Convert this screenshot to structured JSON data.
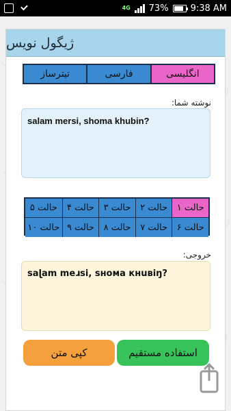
{
  "status_bar": {
    "network_label": "4G",
    "battery": "73%",
    "time": "9:38 AM"
  },
  "app": {
    "title": "ژیگول نویس"
  },
  "tabs": [
    {
      "label": "انگلیسی",
      "active": true
    },
    {
      "label": "فارسی",
      "active": false
    },
    {
      "label": "تیترساز",
      "active": false
    }
  ],
  "input": {
    "label": "نوشته شما:",
    "value": "salam mersi, shoma khubin?"
  },
  "styles": {
    "row1": [
      "حالت ۱",
      "حالت ۲",
      "حالت ۳",
      "حالت ۴",
      "حالت ۵"
    ],
    "row2": [
      "حالت ۶",
      "حالت ۷",
      "حالت ۸",
      "حالت ۹",
      "حالت ۱۰"
    ],
    "active_index": 0
  },
  "output": {
    "label": "خروجی:",
    "value": "saɭam meɹsi, sнoмa кнuвiŋ?"
  },
  "buttons": {
    "use_direct": "استفاده مستقیم",
    "copy_text": "کپی متن"
  },
  "colors": {
    "accent_blue": "#3a8ad2",
    "accent_pink": "#e965c7",
    "header_blue": "#a8d4ec",
    "green": "#37c35a",
    "orange": "#f4a13d"
  },
  "icons": {
    "share": "share-icon"
  }
}
